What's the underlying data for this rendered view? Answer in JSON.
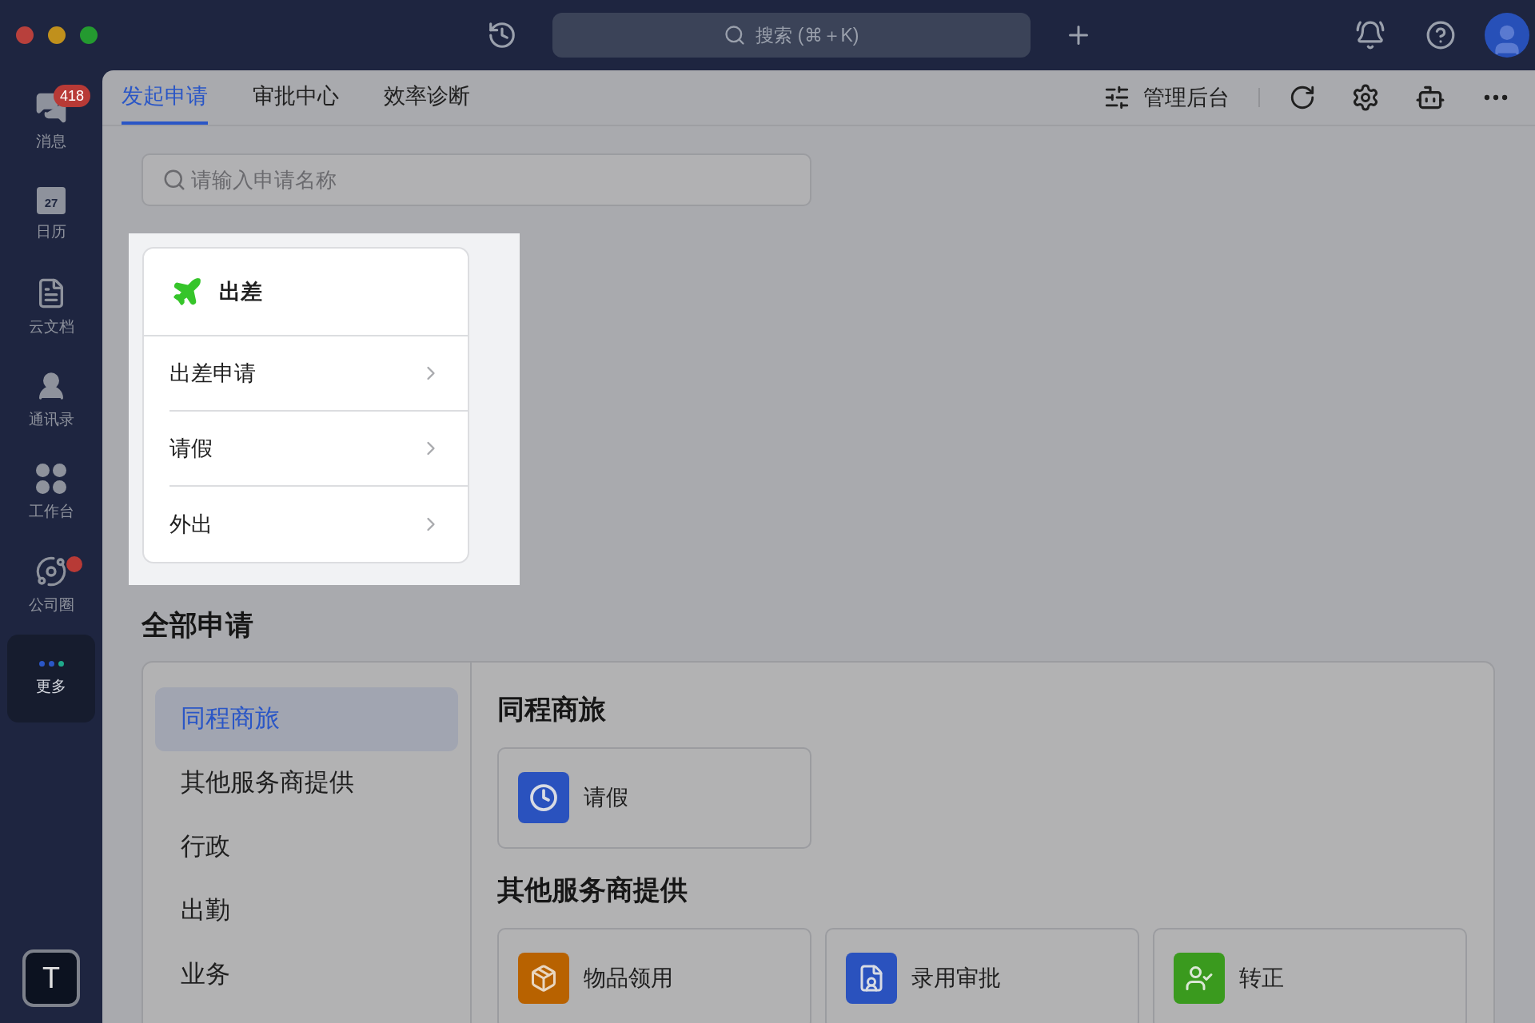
{
  "top_bar": {
    "search": {
      "placeholder": "搜索 (⌘＋K)"
    }
  },
  "sidebar": {
    "items": [
      {
        "kind": "chat",
        "label": "消息",
        "badge": "418",
        "dot": false,
        "selected": false
      },
      {
        "kind": "calendar",
        "label": "日历",
        "icon_text": "27",
        "dot": false,
        "selected": false
      },
      {
        "kind": "docs",
        "label": "云文档",
        "dot": false,
        "selected": false
      },
      {
        "kind": "contacts",
        "label": "通讯录",
        "dot": false,
        "selected": false
      },
      {
        "kind": "workspace",
        "label": "工作台",
        "dot": false,
        "selected": false
      },
      {
        "kind": "planet",
        "label": "公司圈",
        "dot": true,
        "selected": false
      },
      {
        "kind": "more",
        "label": "更多",
        "dot": false,
        "selected": true
      }
    ],
    "workspace_initial": "T"
  },
  "tabs": [
    {
      "label": "发起申请",
      "selected": true
    },
    {
      "label": "审批中心",
      "selected": false
    },
    {
      "label": "效率诊断",
      "selected": false
    }
  ],
  "toolbar": {
    "admin_label": "管理后台"
  },
  "request_search": {
    "placeholder": "请输入申请名称"
  },
  "popup": {
    "title": "出差",
    "items": [
      "出差申请",
      "请假",
      "外出"
    ]
  },
  "all_requests": {
    "title": "全部申请",
    "categories": [
      {
        "label": "同程商旅",
        "selected": true
      },
      {
        "label": "其他服务商提供",
        "selected": false
      },
      {
        "label": "行政",
        "selected": false
      },
      {
        "label": "出勤",
        "selected": false
      },
      {
        "label": "业务",
        "selected": false
      }
    ],
    "sections": [
      {
        "title": "同程商旅",
        "apps": [
          {
            "name": "请假",
            "kind": "clock",
            "color": "#2a52be"
          }
        ]
      },
      {
        "title": "其他服务商提供",
        "apps": [
          {
            "name": "物品领用",
            "kind": "box",
            "color": "#b86200"
          },
          {
            "name": "录用审批",
            "kind": "form",
            "color": "#2a52be"
          },
          {
            "name": "转正",
            "kind": "user-check",
            "color": "#3a9a1e"
          }
        ]
      }
    ]
  }
}
